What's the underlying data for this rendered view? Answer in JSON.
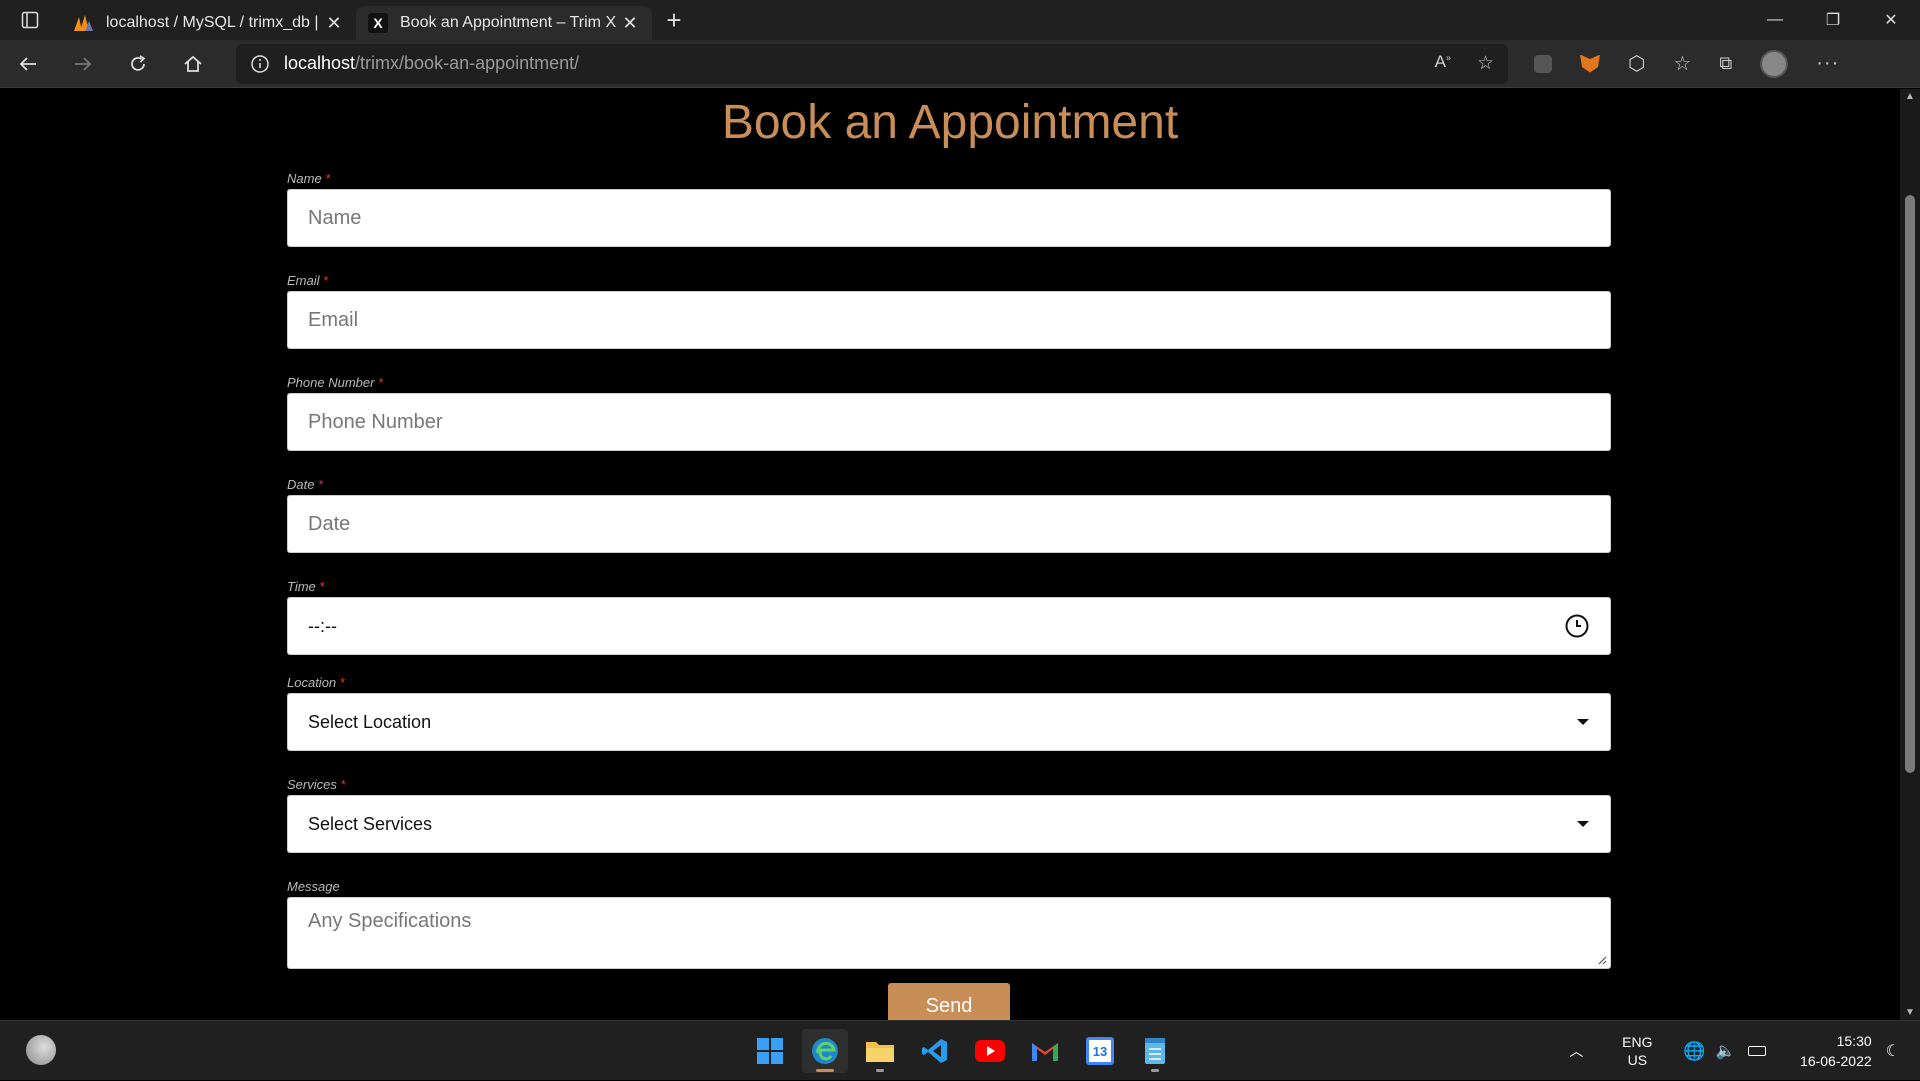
{
  "browser": {
    "tabs": [
      {
        "title": "localhost / MySQL / trimx_db | pl",
        "active": false
      },
      {
        "title": "Book an Appointment – Trim X",
        "active": true
      }
    ],
    "favicon_x": "X",
    "address": {
      "host": "localhost",
      "path": "/trimx/book-an-appointment/"
    }
  },
  "page": {
    "title": "Book an Appointment",
    "required_marker": "*",
    "fields": {
      "name": {
        "label": "Name",
        "placeholder": "Name"
      },
      "email": {
        "label": "Email",
        "placeholder": "Email"
      },
      "phone": {
        "label": "Phone Number",
        "placeholder": "Phone Number"
      },
      "date": {
        "label": "Date",
        "placeholder": "Date"
      },
      "time": {
        "label": "Time",
        "value": "--:--"
      },
      "location": {
        "label": "Location",
        "value": "Select Location"
      },
      "services": {
        "label": "Services",
        "value": "Select Services"
      },
      "message": {
        "label": "Message",
        "placeholder": "Any Specifications"
      }
    },
    "send_label": "Send"
  },
  "taskbar": {
    "lang": "ENG",
    "region": "US",
    "time": "15:30",
    "date": "16-06-2022",
    "calendar_day": "13"
  },
  "colors": {
    "accent": "#c98d57",
    "background": "#000000",
    "chrome": "#202020"
  }
}
